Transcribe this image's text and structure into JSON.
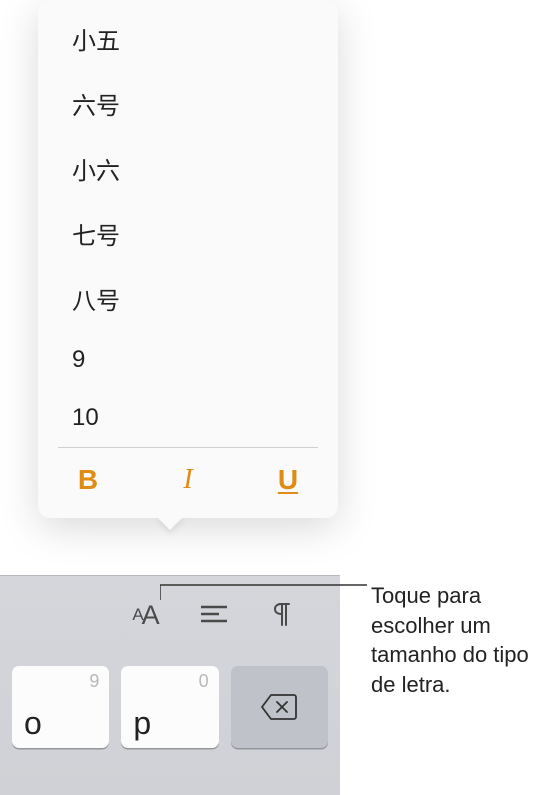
{
  "popover": {
    "sizes": [
      "小五",
      "六号",
      "小六",
      "七号",
      "八号",
      "9",
      "10"
    ],
    "format": {
      "bold": "B",
      "italic": "I",
      "underline": "U"
    }
  },
  "keyboard": {
    "keys": [
      {
        "hint": "9",
        "main": "o"
      },
      {
        "hint": "0",
        "main": "p"
      }
    ]
  },
  "callout": {
    "text": "Toque para escolher um tamanho do tipo de letra."
  }
}
